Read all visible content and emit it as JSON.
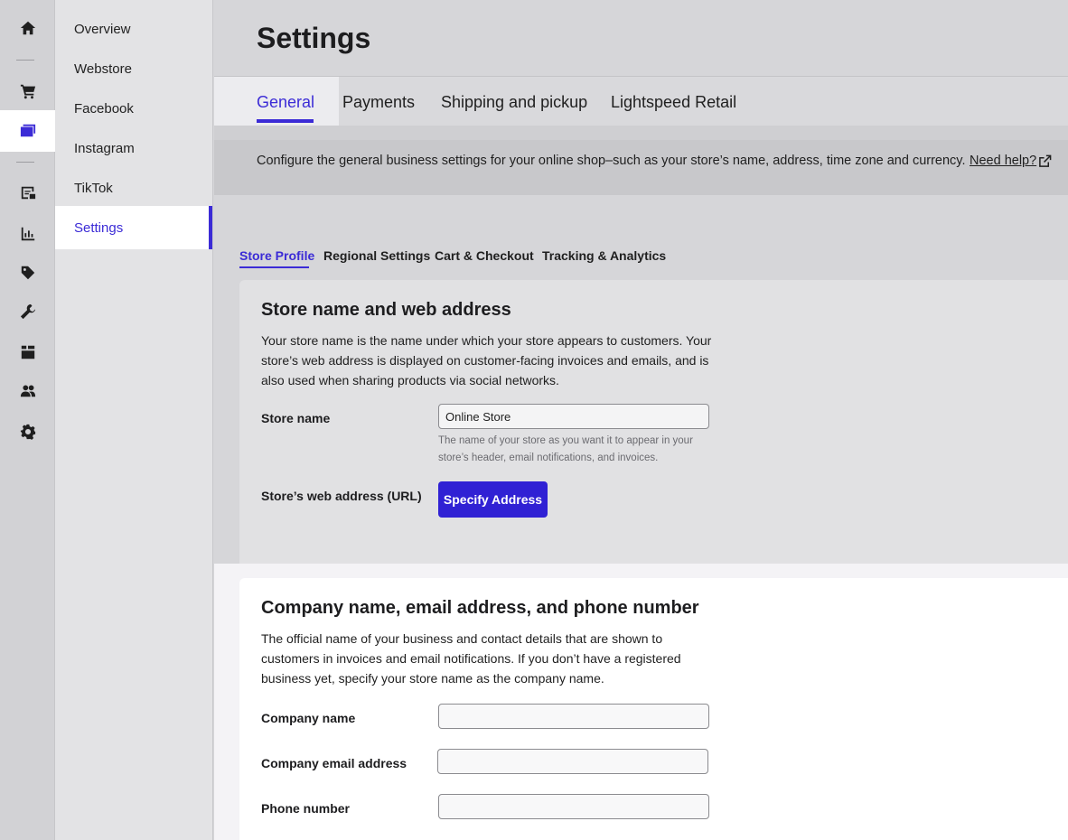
{
  "rail": {
    "icons": [
      "home-icon",
      "cart-icon",
      "channels-icon",
      "orders-icon",
      "reports-icon",
      "tag-icon",
      "wrench-icon",
      "catalog-icon",
      "customers-icon",
      "gear-icon"
    ],
    "active": "channels-icon",
    "accent_color": "#3b2bd6"
  },
  "subnav": {
    "items": [
      {
        "label": "Overview"
      },
      {
        "label": "Webstore"
      },
      {
        "label": "Facebook"
      },
      {
        "label": "Instagram"
      },
      {
        "label": "TikTok"
      },
      {
        "label": "Settings"
      }
    ],
    "active_label": "Settings"
  },
  "page": {
    "title": "Settings"
  },
  "tabs": {
    "items": [
      {
        "label": "General"
      },
      {
        "label": "Payments"
      },
      {
        "label": "Shipping and pickup"
      },
      {
        "label": "Lightspeed Retail"
      }
    ],
    "active_label": "General"
  },
  "description": {
    "text": "Configure the general business settings for your online shop–such as your store’s name, address, time zone and currency.",
    "help_link": "Need help?"
  },
  "subtabs": {
    "items": [
      {
        "label": "Store Profile"
      },
      {
        "label": "Regional Settings"
      },
      {
        "label": "Cart & Checkout"
      },
      {
        "label": "Tracking & Analytics"
      }
    ],
    "active_label": "Store Profile"
  },
  "store_section": {
    "title": "Store name and web address",
    "description": "Your store name is the name under which your store appears to customers. Your store’s web address is displayed on customer-facing invoices and emails, and is also used when sharing products via social networks.",
    "store_name_label": "Store name",
    "store_name_value": "Online Store",
    "store_name_hint": "The name of your store as you want it to appear in your store’s header, email notifications, and invoices.",
    "web_address_label": "Store’s web address (URL)",
    "specify_button": "Specify Address"
  },
  "company_section": {
    "title": "Company name, email address, and phone number",
    "description": "The official name of your business and contact details that are shown to customers in invoices and email notifications. If you don’t have a registered business yet, specify your store name as the company name.",
    "company_name_label": "Company name",
    "company_name_value": "",
    "email_label": "Company email address",
    "email_value": "",
    "phone_label": "Phone number",
    "phone_value": ""
  }
}
